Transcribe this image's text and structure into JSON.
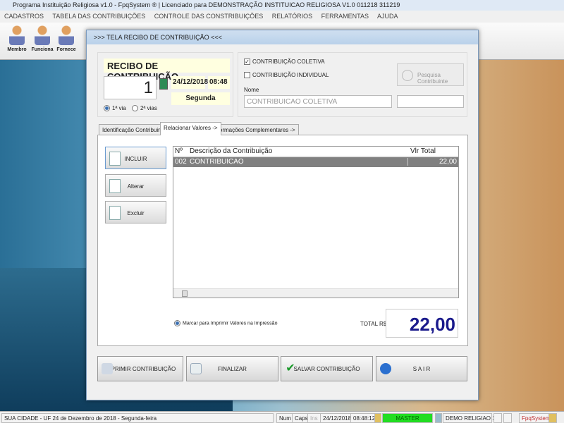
{
  "window": {
    "title": "Programa Instituição Religiosa v1.0 - FpqSystem ® | Licenciado para  DEMONSTRAÇÃO INSTITUICAO RELIGIOSA V1.0 011218 311219"
  },
  "menu": [
    "CADASTROS",
    "TABELA DAS CONTRIBUIÇÕES",
    "CONTROLE DAS CONSTRIBUIÇÕES",
    "RELATÓRIOS",
    "FERRAMENTAS",
    "AJUDA"
  ],
  "toolbar": [
    "Membro",
    "Funciona",
    "Fornece"
  ],
  "dialog": {
    "title": ">>>   TELA RECIBO DE CONTRIBUIÇÃO   <<<",
    "receipt_title": "RECIBO DE CONTRIBUIÇÃO",
    "number": "1",
    "date": "24/12/2018",
    "time": "08:48",
    "weekday": "Segunda",
    "via1": "1ª via",
    "via2": "2ª vias",
    "chk_coletiva": "CONTRIBUIÇÃO COLETIVA",
    "chk_individual": "CONTRIBUIÇÃO INDIVIDUAL",
    "search_button": "Pesquisa Contribuinte",
    "name_label": "Nome",
    "name_value": "CONTRIBUICAO COLETIVA",
    "tabs": [
      "Identificação Contribuinte ->",
      "Relacionar Valores ->",
      "Informações Complementares ->"
    ],
    "side_buttons": [
      "INCLUIR",
      "Alterar",
      "Excluir"
    ],
    "grid": {
      "headers": [
        "Nº",
        "Descrição da Contribuição",
        "Vlr Total"
      ],
      "rows": [
        [
          "002",
          "CONTRIBUICAO",
          "22,00"
        ]
      ]
    },
    "print_values_label": "Marcar para Imprimir Valores na Impressão",
    "total_label": "TOTAL R$",
    "total_value": "22,00",
    "buttons": [
      "IMPRIMIR CONTRIBUIÇÃO",
      "FINALIZAR",
      "SALVAR CONTRIBUIÇÃO",
      "S A I R"
    ]
  },
  "status": {
    "city": "SUA CIDADE - UF 24 de Dezembro de 2018 - Segunda-feira",
    "num": "Num",
    "caps": "Caps",
    "ins": "Ins",
    "date": "24/12/2018",
    "time": "08:48:12",
    "user": "MASTER",
    "version": "DEMO RELIGIAO 1.0",
    "brand": "FpqSystem"
  }
}
